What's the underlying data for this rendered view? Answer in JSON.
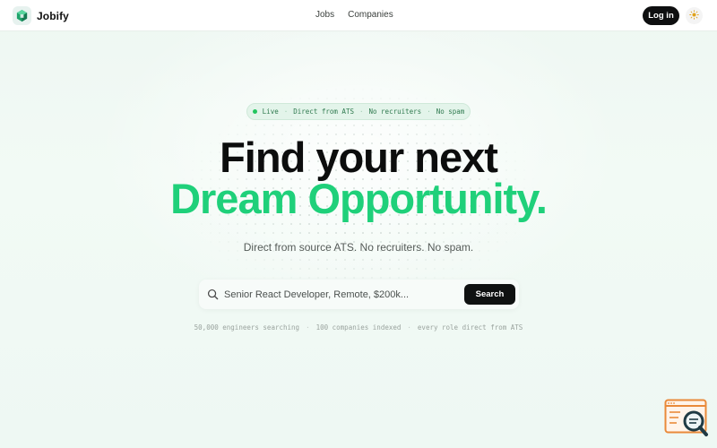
{
  "header": {
    "brand": "Jobify",
    "nav": [
      {
        "label": "Jobs"
      },
      {
        "label": "Companies"
      }
    ],
    "login_label": "Log in",
    "theme_icon": "sun-icon"
  },
  "hero": {
    "badge": {
      "status": "Live",
      "items": [
        "Direct from ATS",
        "No recruiters",
        "No spam"
      ]
    },
    "title_line1": "Find your next",
    "title_line2": "Dream Opportunity.",
    "subtitle": "Direct from source ATS. No recruiters. No spam."
  },
  "search": {
    "placeholder": "Senior React Developer, Remote, $200k...",
    "value": "",
    "button_label": "Search"
  },
  "stats": [
    "50,000 engineers searching",
    "100 companies indexed",
    "every role direct from ATS"
  ],
  "colors": {
    "accent": "#1fd07a",
    "dark": "#0e0f10",
    "live_dot": "#22c55e"
  }
}
